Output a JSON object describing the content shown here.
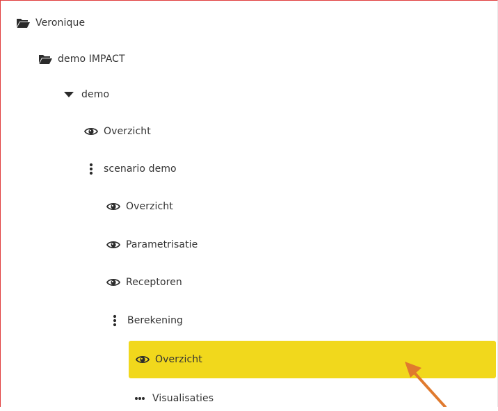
{
  "tree": {
    "items": [
      {
        "label": "Veronique",
        "icon": "folder-open-icon"
      },
      {
        "label": "demo IMPACT",
        "icon": "folder-open-icon"
      },
      {
        "label": "demo",
        "icon": "caret-down-icon"
      },
      {
        "label": "Overzicht",
        "icon": "eye-icon"
      },
      {
        "label": "scenario demo",
        "icon": "vertical-dots-icon"
      },
      {
        "label": "Overzicht",
        "icon": "eye-icon"
      },
      {
        "label": "Parametrisatie",
        "icon": "eye-icon"
      },
      {
        "label": "Receptoren",
        "icon": "eye-icon"
      },
      {
        "label": "Berekening",
        "icon": "vertical-dots-icon"
      },
      {
        "label": "Overzicht",
        "icon": "eye-icon",
        "selected": true
      },
      {
        "label": "Visualisaties",
        "icon": "horizontal-dots-icon"
      }
    ]
  },
  "colors": {
    "selected_background": "#f1d81c",
    "frame_border": "#e03c3c",
    "annotation_arrow": "#e07a2e",
    "text": "#333333"
  }
}
